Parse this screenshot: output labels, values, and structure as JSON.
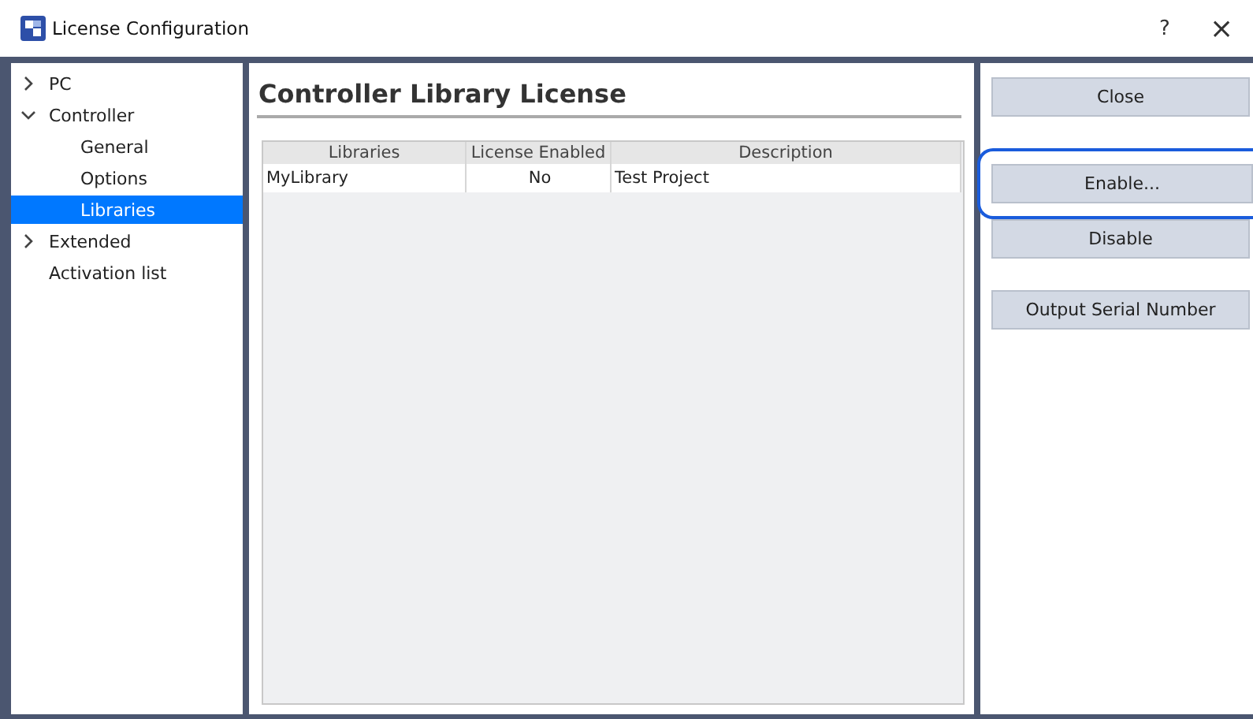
{
  "window": {
    "title": "License Configuration",
    "help": "?",
    "close": "×"
  },
  "tree": [
    {
      "label": "PC",
      "expandable": true,
      "expanded": false,
      "selected": false
    },
    {
      "label": "Controller",
      "expandable": true,
      "expanded": true,
      "selected": false,
      "children": [
        {
          "label": "General",
          "selected": false
        },
        {
          "label": "Options",
          "selected": false
        },
        {
          "label": "Libraries",
          "selected": true
        }
      ]
    },
    {
      "label": "Extended",
      "expandable": true,
      "expanded": false,
      "selected": false
    },
    {
      "label": "Activation list",
      "expandable": false,
      "selected": false
    }
  ],
  "heading": "Controller Library License",
  "table": {
    "columns": [
      "Libraries",
      "License Enabled",
      "Description"
    ],
    "rows": [
      [
        "MyLibrary",
        "No",
        "Test Project"
      ]
    ]
  },
  "buttons": [
    {
      "label": "Close",
      "focused": false
    },
    {
      "label": "Enable...",
      "focused": true
    },
    {
      "label": "Disable",
      "focused": false
    },
    {
      "label": "Output Serial Number",
      "focused": false
    }
  ]
}
